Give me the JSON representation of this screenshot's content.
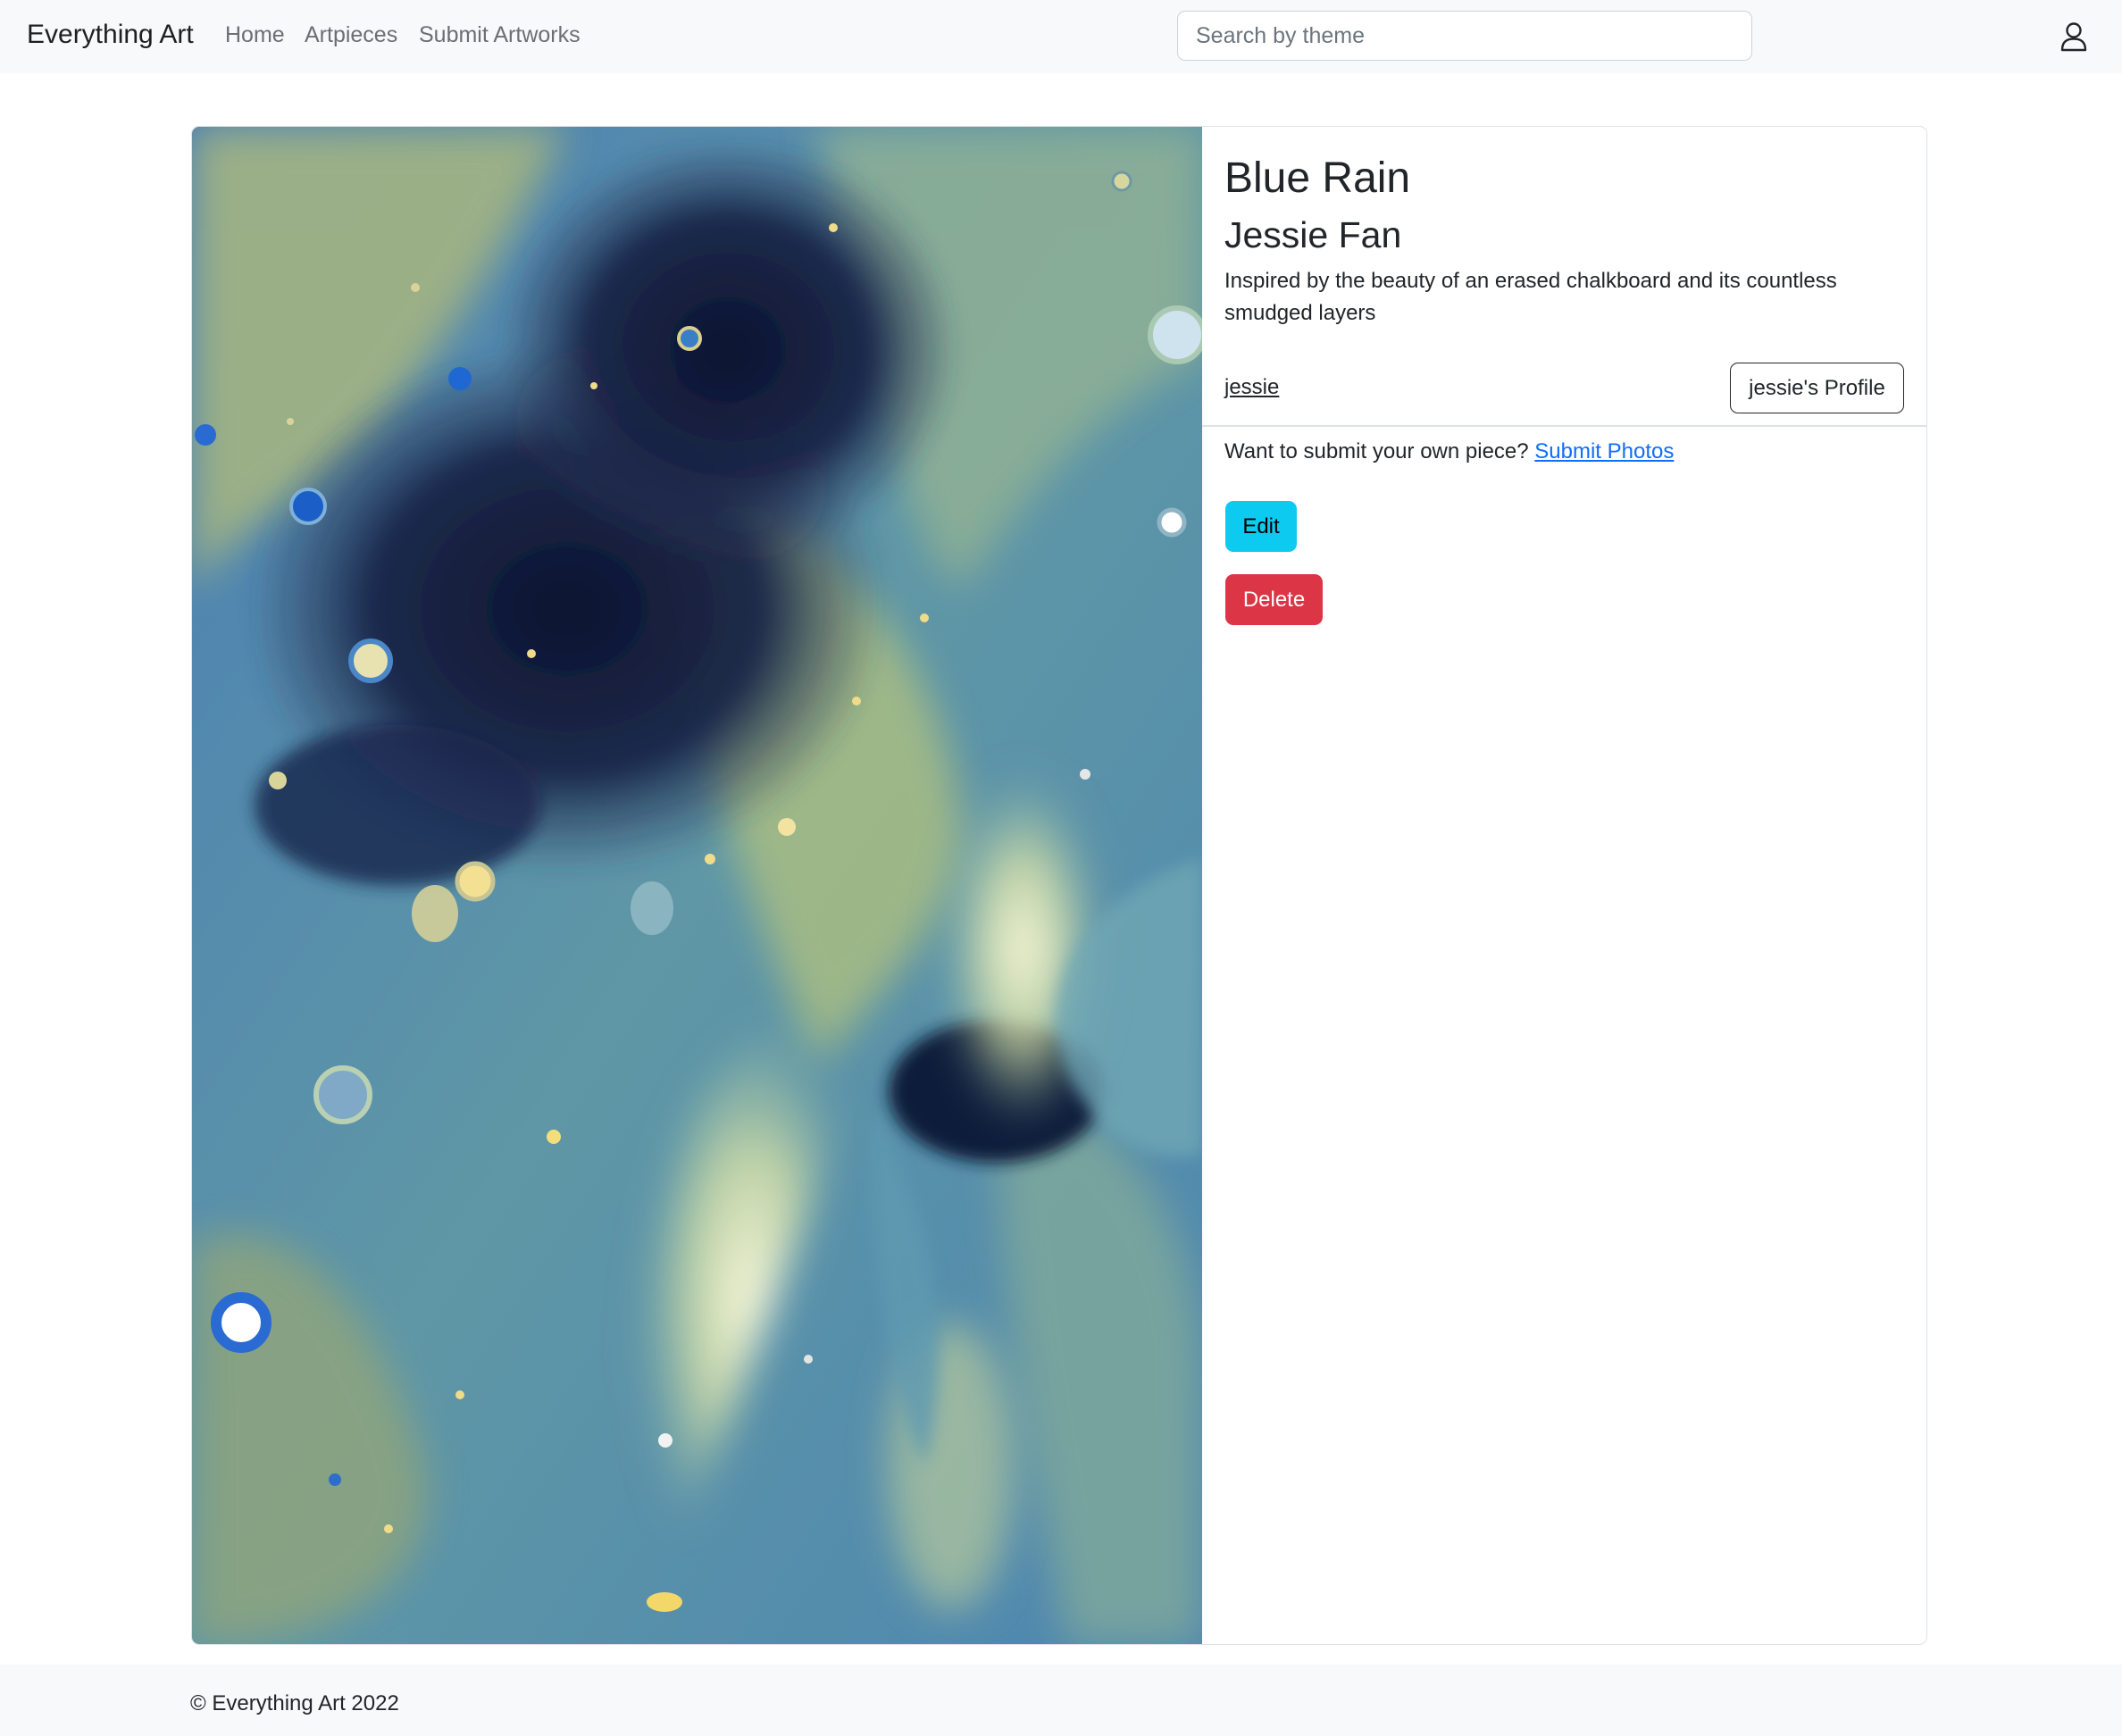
{
  "navbar": {
    "brand": "Everything Art",
    "links": [
      "Home",
      "Artpieces",
      "Submit Artworks"
    ],
    "search_placeholder": "Search by theme",
    "user_icon": "person-icon"
  },
  "artwork": {
    "image_icon": "fluid-art-painting",
    "title": "Blue Rain",
    "artist": "Jessie Fan",
    "description": "Inspired by the beauty of an erased chalkboard and its countless smudged layers",
    "username": "jessie",
    "profile_button": "jessie's Profile",
    "submit_prompt": "Want to submit your own piece? ",
    "submit_link": "Submit Photos",
    "edit_button": "Edit",
    "delete_button": "Delete"
  },
  "footer": {
    "text": "© Everything Art 2022"
  },
  "colors": {
    "navbar_bg": "#f8f9fa",
    "edit": "#0dcaf0",
    "delete": "#dc3545",
    "link": "#0d6efd"
  }
}
